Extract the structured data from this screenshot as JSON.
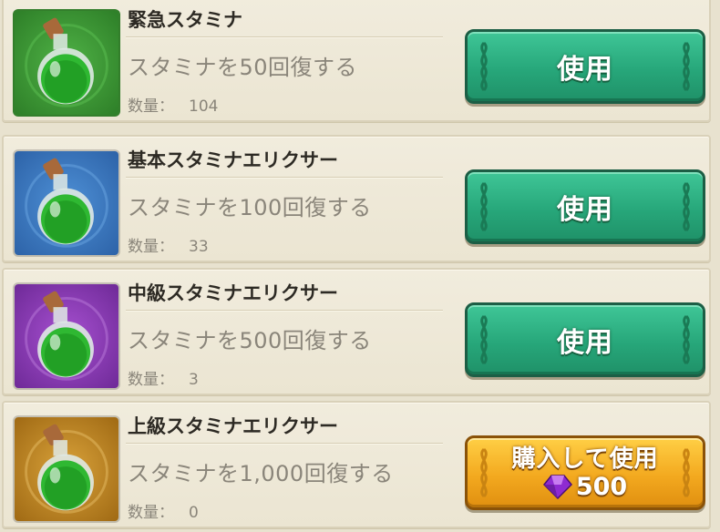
{
  "items": [
    {
      "name": "緊急スタミナ",
      "description": "スタミナを50回復する",
      "quantity_label": "数量：",
      "quantity": "104",
      "icon_name": "potion-icon",
      "icon_bg": "#3f9a35",
      "button": {
        "label": "使用",
        "style": "green"
      }
    },
    {
      "name": "基本スタミナエリクサー",
      "description": "スタミナを100回復する",
      "quantity_label": "数量：",
      "quantity": "33",
      "icon_name": "potion-icon",
      "icon_bg": "#3e7dc4",
      "button": {
        "label": "使用",
        "style": "green"
      }
    },
    {
      "name": "中級スタミナエリクサー",
      "description": "スタミナを500回復する",
      "quantity_label": "数量：",
      "quantity": "3",
      "icon_name": "potion-icon",
      "icon_bg": "#8d3fb8",
      "button": {
        "label": "使用",
        "style": "green"
      }
    },
    {
      "name": "上級スタミナエリクサー",
      "description": "スタミナを1,000回復する",
      "quantity_label": "数量：",
      "quantity": "0",
      "icon_name": "potion-icon",
      "icon_bg": "#c58a1f",
      "button": {
        "label": "購入して使用",
        "style": "gold",
        "price": "500",
        "currency_icon": "gem-icon"
      }
    }
  ],
  "colors": {
    "panel_bg": "#e8e2cf",
    "green_button": "#27a77a",
    "gold_button": "#f3a91f",
    "gem": "#8e2bd1"
  }
}
